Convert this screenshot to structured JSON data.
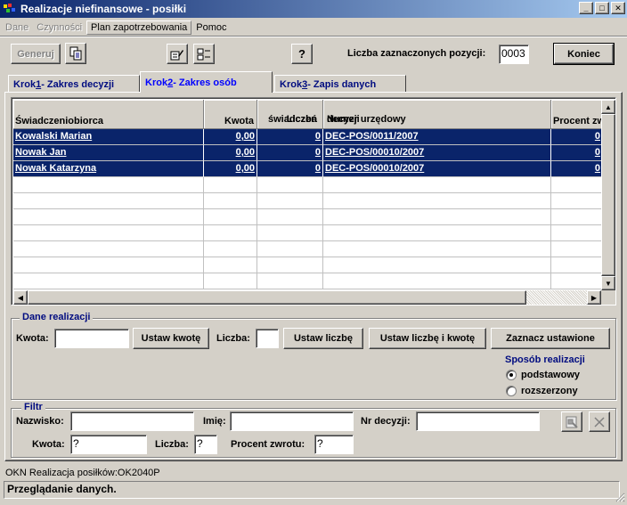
{
  "window": {
    "title": "Realizacje niefinansowe - posiłki",
    "minimize": "_",
    "maximize": "□",
    "close": "✕"
  },
  "menu": {
    "items": [
      {
        "label": "Dane",
        "disabled": true
      },
      {
        "label": "Czynności",
        "disabled": true
      },
      {
        "label": "Plan zapotrzebowania",
        "disabled": false
      },
      {
        "label": "Pomoc",
        "disabled": false
      }
    ]
  },
  "toolbar": {
    "generuj": "Generuj",
    "help": "?",
    "count_label": "Liczba zaznaczonych pozycji:",
    "count_value": "0003",
    "koniec": "Koniec"
  },
  "tabs": [
    {
      "prefix": "Krok ",
      "num": "1",
      "suffix": " - Zakres decyzji"
    },
    {
      "prefix": "Krok ",
      "num": "2",
      "suffix": " - Zakres osób"
    },
    {
      "prefix": "Krok ",
      "num": "3",
      "suffix": " - Zapis danych"
    }
  ],
  "grid": {
    "columns": [
      "Świadczeniobiorca",
      "Kwota",
      "Liczba świadczeń",
      "Numer urzędowy decyzji",
      "Procent zwrotu"
    ],
    "col1": "Świadczeniobiorca",
    "col2": "Kwota",
    "col3a": "Liczba",
    "col3b": "świadczeń",
    "col4a": "Numer urzędowy",
    "col4b": "decyzji",
    "col5": "Procent zw",
    "rows": [
      {
        "name": "Kowalski Marian",
        "kwota": "0,00",
        "liczba": "0",
        "decyzja": "DEC-POS/0011/2007",
        "procent": "0"
      },
      {
        "name": "Nowak Jan",
        "kwota": "0,00",
        "liczba": "0",
        "decyzja": "DEC-POS/00010/2007",
        "procent": "0"
      },
      {
        "name": "Nowak Katarzyna",
        "kwota": "0,00",
        "liczba": "0",
        "decyzja": "DEC-POS/00010/2007",
        "procent": "0"
      }
    ]
  },
  "dane_realizacji": {
    "title": "Dane realizacji",
    "kwota_label": "Kwota:",
    "kwota_value": "",
    "ustaw_kwote": "Ustaw kwotę",
    "liczba_label": "Liczba:",
    "liczba_value": "",
    "ustaw_liczbe": "Ustaw liczbę",
    "ustaw_liczbe_kwote": "Ustaw liczbę i kwotę",
    "zaznacz": "Zaznacz ustawione",
    "sposob_title": "Sposób realizacji",
    "opt1": "podstawowy",
    "opt2": "rozszerzony",
    "selected": "podstawowy"
  },
  "filtr": {
    "title": "Filtr",
    "nazwisko_label": "Nazwisko:",
    "nazwisko_value": "",
    "imie_label": "Imię:",
    "imie_value": "",
    "nr_decyzji_label": "Nr decyzji:",
    "nr_decyzji_value": "",
    "kwota_label": "Kwota:",
    "kwota_value": "?",
    "liczba_label": "Liczba:",
    "liczba_value": "?",
    "procent_label": "Procent zwrotu:",
    "procent_value": "?"
  },
  "status": {
    "module": "OKN Realizacja posiłków:OK2040P",
    "message": "Przeglądanie danych."
  }
}
